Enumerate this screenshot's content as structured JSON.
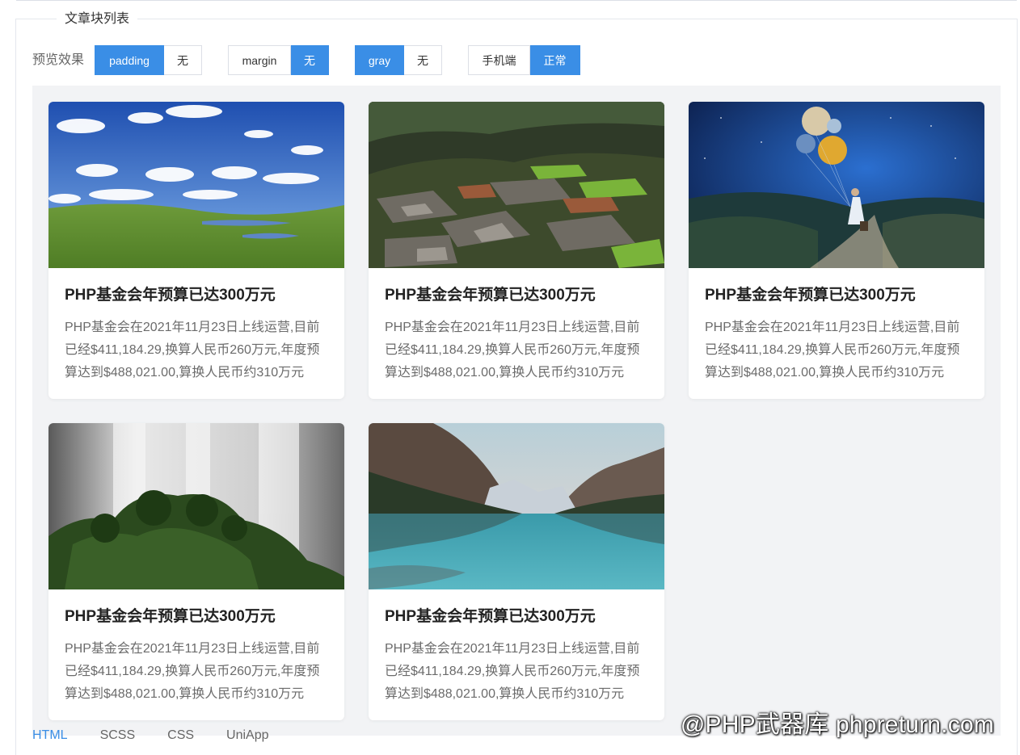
{
  "section": {
    "legend": "文章块列表"
  },
  "toolbar": {
    "label": "预览效果",
    "groups": [
      {
        "options": [
          "padding",
          "无"
        ],
        "active": 0
      },
      {
        "options": [
          "margin",
          "无"
        ],
        "active": 1
      },
      {
        "options": [
          "gray",
          "无"
        ],
        "active": 0
      },
      {
        "options": [
          "手机端",
          "正常"
        ],
        "active": 1
      }
    ]
  },
  "cards": [
    {
      "image": "meadow-sky-photo",
      "title": "PHP基金会年预算已达300万元",
      "desc": "PHP基金会在2021年11月23日上线运营,目前已经$411,184.29,换算人民币260万元,年度预算达到$488,021.00,算换人民币约310万元"
    },
    {
      "image": "rice-terraces-photo",
      "title": "PHP基金会年预算已达300万元",
      "desc": "PHP基金会在2021年11月23日上线运营,目前已经$411,184.29,换算人民币260万元,年度预算达到$488,021.00,算换人民币约310万元"
    },
    {
      "image": "girl-planet-balloons-photo",
      "title": "PHP基金会年预算已达300万元",
      "desc": "PHP基金会在2021年11月23日上线运营,目前已经$411,184.29,换算人民币260万元,年度预算达到$488,021.00,算换人民币约310万元"
    },
    {
      "image": "waterfall-tree-photo",
      "title": "PHP基金会年预算已达300万元",
      "desc": "PHP基金会在2021年11月23日上线运营,目前已经$411,184.29,换算人民币260万元,年度预算达到$488,021.00,算换人民币约310万元"
    },
    {
      "image": "mountain-lake-photo",
      "title": "PHP基金会年预算已达300万元",
      "desc": "PHP基金会在2021年11月23日上线运营,目前已经$411,184.29,换算人民币260万元,年度预算达到$488,021.00,算换人民币约310万元"
    }
  ],
  "tabs": {
    "items": [
      "HTML",
      "SCSS",
      "CSS",
      "UniApp"
    ],
    "active": 0
  },
  "watermark": "@PHP武器库 phpreturn.com",
  "colors": {
    "accent": "#3a8ee6",
    "preview_bg": "#f2f3f5"
  }
}
